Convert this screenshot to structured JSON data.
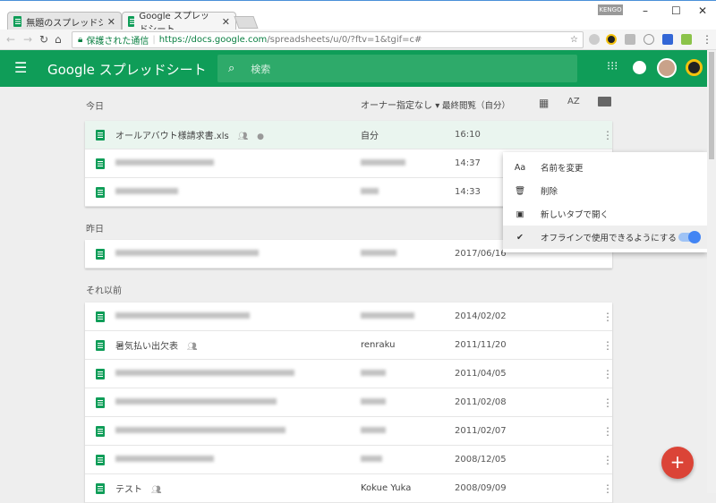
{
  "browser": {
    "tabs": [
      {
        "label": "無題のスプレッドシート - Go"
      },
      {
        "label": "Google スプレッドシート"
      }
    ],
    "user": "KENGO",
    "secure_label": "保護された通信",
    "url_host": "https://docs.google.com",
    "url_path": "/spreadsheets/u/0/?ftv=1&tgif=c#"
  },
  "header": {
    "app_title": "Google スプレッドシート",
    "search_placeholder": "検索"
  },
  "toolbar": {
    "owner_filter": "オーナー指定なし",
    "sort_label": "最終閲覧（自分）"
  },
  "sections": [
    {
      "title": "今日",
      "rows": [
        {
          "name": "オールアバウト様請求書.xls",
          "owner": "自分",
          "date": "16:10"
        },
        {
          "name": "",
          "owner": "",
          "date": "14:37"
        },
        {
          "name": "",
          "owner": "",
          "date": "14:33"
        }
      ]
    },
    {
      "title": "昨日",
      "rows": [
        {
          "name": "",
          "owner": "",
          "date": "2017/06/16"
        }
      ]
    },
    {
      "title": "それ以前",
      "rows": [
        {
          "name": "",
          "owner": "",
          "date": "2014/02/02"
        },
        {
          "name": "暑気払い出欠表",
          "owner": "renraku",
          "date": "2011/11/20"
        },
        {
          "name": "",
          "owner": "",
          "date": "2011/04/05"
        },
        {
          "name": "",
          "owner": "",
          "date": "2011/02/08"
        },
        {
          "name": "",
          "owner": "",
          "date": "2011/02/07"
        },
        {
          "name": "",
          "owner": "",
          "date": "2008/12/05"
        },
        {
          "name": "テスト",
          "owner": "Kokue Yuka",
          "date": "2008/09/09"
        }
      ]
    }
  ],
  "context_menu": {
    "items": [
      {
        "icon": "Aa",
        "label": "名前を変更"
      },
      {
        "label": "削除"
      },
      {
        "label": "新しいタブで開く"
      },
      {
        "label": "オフラインで使用できるようにする"
      }
    ],
    "offline_enabled": true
  },
  "fab": "+",
  "colors": {
    "brand": "#0f9d58",
    "fab": "#db4437",
    "toggle": "#4285f4"
  }
}
